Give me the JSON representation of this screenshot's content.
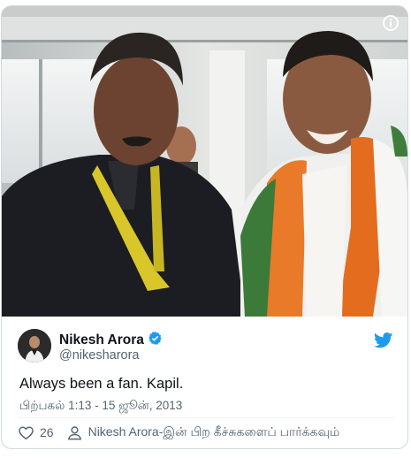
{
  "tweet": {
    "display_name": "Nikesh Arora",
    "handle": "@nikesharora",
    "verified": true,
    "text": "Always been a fan. Kapil.",
    "timestamp": "பிற்பகல் 1:13 - 15 ஜூன், 2013",
    "like_count": "26",
    "profile_link_label": "Nikesh Arora-இன் பிற கீச்சுகளைப் பார்க்கவும்"
  },
  "icons": {
    "info": "info-icon",
    "verified": "verified-badge-icon",
    "brand": "twitter-bird-icon",
    "like": "heart-icon",
    "profile": "person-icon"
  },
  "colors": {
    "brand_blue": "#1d9bf0",
    "text_primary": "#0f1419",
    "text_secondary": "#536471",
    "border": "#cfd9de"
  }
}
